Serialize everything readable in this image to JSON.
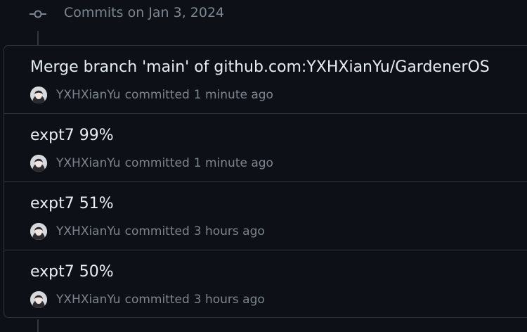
{
  "group": {
    "title": "Commits on Jan 3, 2024",
    "icon": "git-commit-icon"
  },
  "commits": [
    {
      "title": "Merge branch 'main' of github.com:YXHXianYu/GardenerOS",
      "author": "YXHXianYu",
      "verb": "committed",
      "time": "1 minute ago"
    },
    {
      "title": "expt7 99%",
      "author": "YXHXianYu",
      "verb": "committed",
      "time": "1 minute ago"
    },
    {
      "title": "expt7 51%",
      "author": "YXHXianYu",
      "verb": "committed",
      "time": "3 hours ago"
    },
    {
      "title": "expt7 50%",
      "author": "YXHXianYu",
      "verb": "committed",
      "time": "3 hours ago"
    }
  ],
  "colors": {
    "background": "#0d1117",
    "border": "#30363d",
    "text_primary": "#e6edf3",
    "text_muted": "#7d8590"
  }
}
